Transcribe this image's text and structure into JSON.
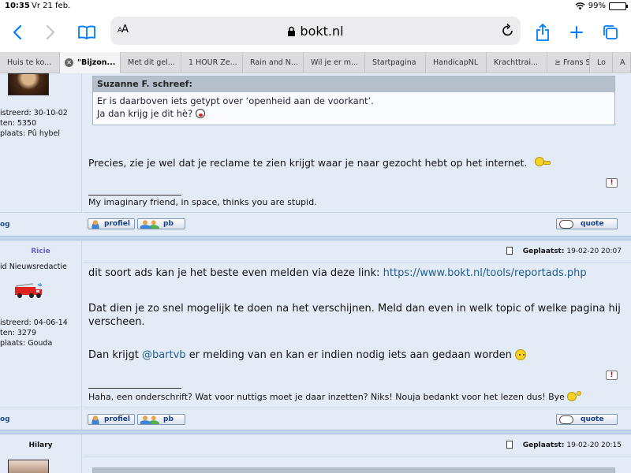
{
  "status": {
    "time": "10:35",
    "date": "Vr 21 feb.",
    "battery": "99%",
    "battery_level": 0.99
  },
  "browser": {
    "aa": "AA",
    "url": "bokt.nl"
  },
  "tabs": [
    {
      "label": "Huis te ko..."
    },
    {
      "label": "\"Bijzon...",
      "active": true
    },
    {
      "label": "Met dit gel..."
    },
    {
      "label": "1 HOUR Ze..."
    },
    {
      "label": "Rain and N..."
    },
    {
      "label": "Wil je er m..."
    },
    {
      "label": "Startpagina"
    },
    {
      "label": "HandicapNL"
    },
    {
      "label": "Krachttrai..."
    },
    {
      "label": "≥ Frans S"
    },
    {
      "label": "Lo"
    },
    {
      "label": "A"
    }
  ],
  "post1": {
    "meta": [
      {
        "label": "istreerd:",
        "value": "30-10-02"
      },
      {
        "label": "ten:",
        "value": "5350"
      },
      {
        "label": "plaats:",
        "value": "Pû hybel"
      }
    ],
    "quote_header": "Suzanne F. schreef:",
    "quote_lines": [
      "Er is daarboven iets getypt over ‘openheid aan de voorkant’.",
      "Ja dan krijg je dit hè?"
    ],
    "text": "Precies, zie je wel dat je reclame te zien krijgt waar je naar gezocht hebt op het internet.",
    "signature": "My imaginary friend, in space, thinks you are stupid.",
    "left_link": "og"
  },
  "post2": {
    "author": "Ricie",
    "role": "id Nieuwsredactie",
    "posted_label": "Geplaatst:",
    "posted_date": "19-02-20 20:07",
    "meta": [
      {
        "label": "istreerd:",
        "value": "04-06-14"
      },
      {
        "label": "ten:",
        "value": "3279"
      },
      {
        "label": "plaats:",
        "value": "Gouda"
      }
    ],
    "p1_text": "dit soort ads kan je het beste even melden via deze link:",
    "p1_link": "https://www.bokt.nl/tools/reportads.php",
    "p2": "Dat dien je zo snel mogelijk te doen na het verschijnen. Meld dan even in welk topic of welke pagina hij verscheen.",
    "p3_pre": "Dan krijgt",
    "p3_mention": "@bartvb",
    "p3_post": "er melding van en kan er indien nodig iets aan gedaan worden",
    "signature": "Haha, een onderschrift? Wat voor nuttigs moet je daar inzetten? Niks! Nouja bedankt voor het lezen dus! Bye",
    "left_link": "og"
  },
  "post3": {
    "author": "Hilary",
    "posted_label": "Geplaatst:",
    "posted_date": "19-02-20 20:15"
  },
  "buttons": {
    "profiel": "profiel",
    "pb": "pb",
    "quote": "quote",
    "report": "!"
  },
  "colors": {
    "accent": "#007aff",
    "forum_bg": "#e3ebf7",
    "link": "#1f5d8f",
    "author_ricie": "#6b5fc9"
  }
}
